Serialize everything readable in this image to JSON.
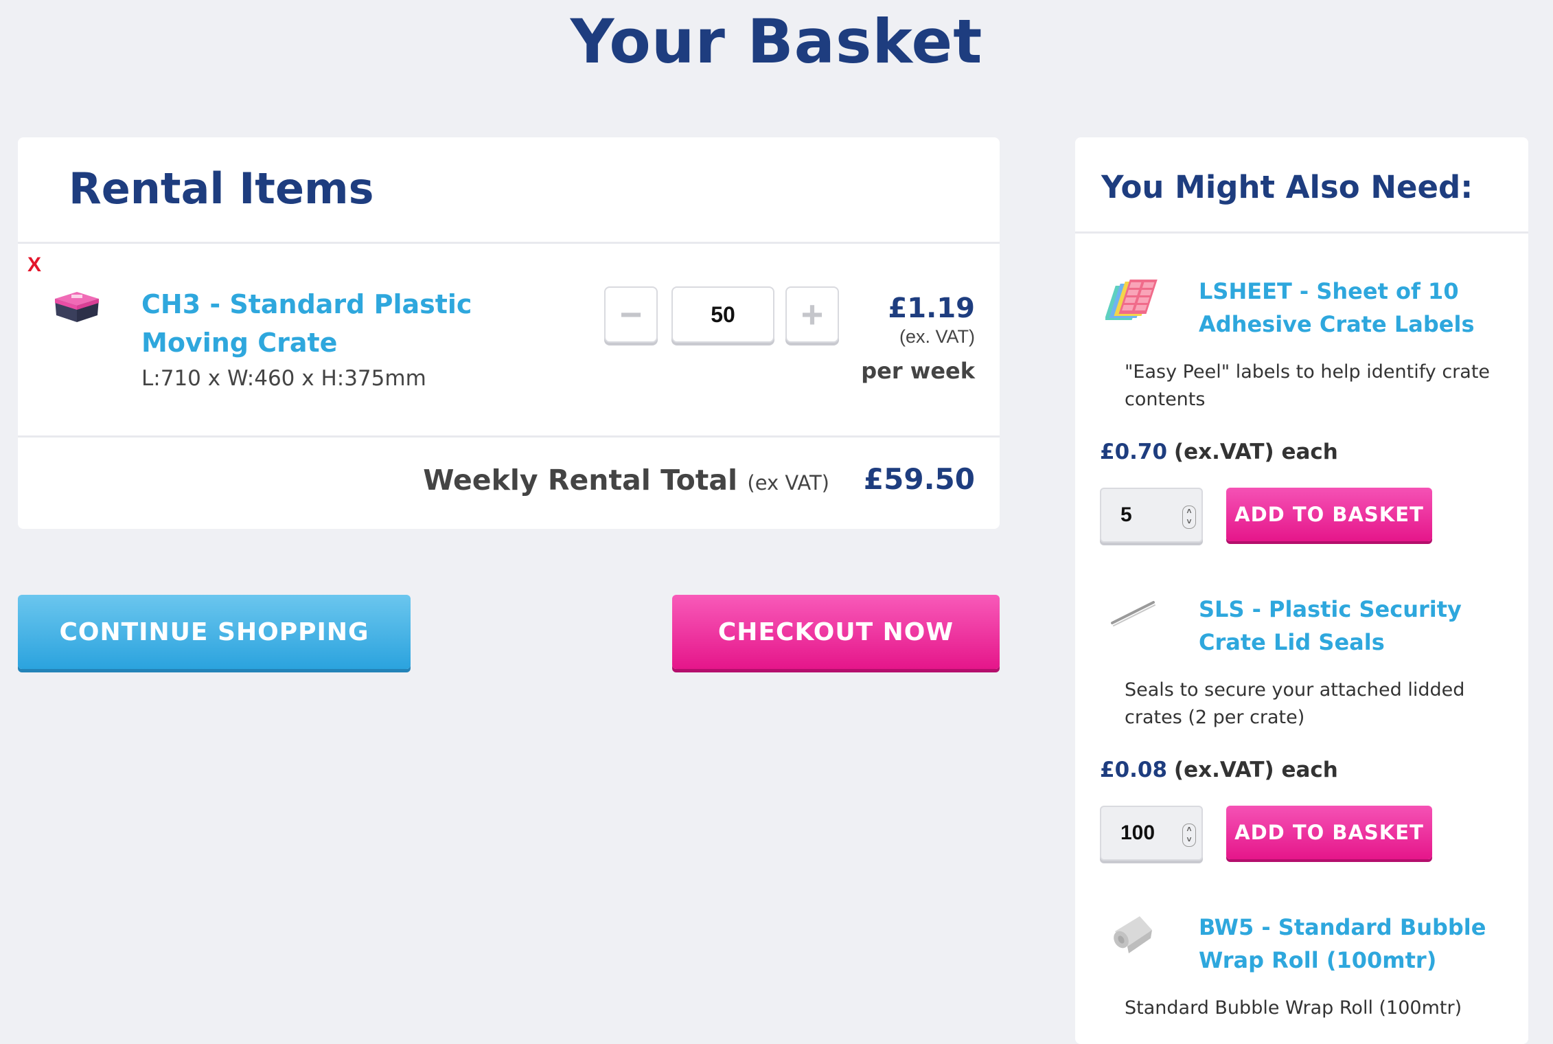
{
  "page": {
    "title": "Your Basket"
  },
  "rental": {
    "heading": "Rental Items",
    "remove_label": "X",
    "item": {
      "name": "CH3 - Standard Plastic Moving Crate",
      "dimensions": "L:710 x W:460 x H:375mm",
      "quantity": "50",
      "minus_label": "−",
      "plus_label": "+",
      "price": "£1.19",
      "vat_note": "(ex. VAT)",
      "period": "per week"
    },
    "total_label": "Weekly Rental Total",
    "total_note": "(ex VAT)",
    "total_amount": "£59.50"
  },
  "actions": {
    "continue_label": "CONTINUE SHOPPING",
    "checkout_label": "CHECKOUT NOW"
  },
  "sidebar": {
    "heading": "You Might Also Need:",
    "items": [
      {
        "name": "LSHEET - Sheet of 10 Adhesive Crate Labels",
        "description": "\"Easy Peel\" labels to help identify crate contents",
        "price": "£0.70",
        "price_suffix": "(ex.VAT) each",
        "quantity": "5",
        "button_label": "ADD TO BASKET",
        "icon": "label-sheet-icon"
      },
      {
        "name": "SLS - Plastic Security Crate Lid Seals",
        "description": "Seals to secure your attached lidded crates (2 per crate)",
        "price": "£0.08",
        "price_suffix": "(ex.VAT) each",
        "quantity": "100",
        "button_label": "ADD TO BASKET",
        "icon": "seal-icon"
      },
      {
        "name": "BW5 - Standard Bubble Wrap Roll (100mtr)",
        "description": "Standard Bubble Wrap Roll (100mtr)",
        "icon": "bubble-wrap-icon"
      }
    ]
  },
  "colors": {
    "navy": "#1e3d7f",
    "link_blue": "#2ea7dd",
    "pink": "#e5168a",
    "remove_red": "#e3162b",
    "background": "#eff0f4"
  }
}
